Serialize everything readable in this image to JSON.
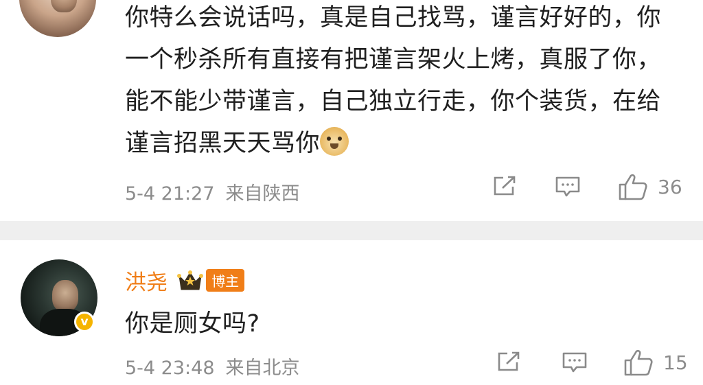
{
  "comments": [
    {
      "text": "你特么会说话吗，真是自己找骂，谨言好好的，你一个秒杀所有直接有把谨言架火上烤，真服了你，能不能少带谨言，自己独立行走，你个装货，在给谨言招黑天天骂你",
      "emoji": "doge-emoji",
      "time": "5-4 21:27",
      "location": "来自陕西",
      "likes": "36"
    },
    {
      "username": "洪尧",
      "badge": "博主",
      "text": "你是厕女吗?",
      "time": "5-4 23:48",
      "location": "来自北京",
      "likes": "15"
    }
  ],
  "colors": {
    "username": "#f07e18",
    "meta": "#8c8c8c",
    "divider": "#efefef",
    "verified": "#f5b400"
  },
  "icons": [
    "share-icon",
    "reply-icon",
    "like-icon",
    "verified-icon",
    "crown-icon"
  ]
}
